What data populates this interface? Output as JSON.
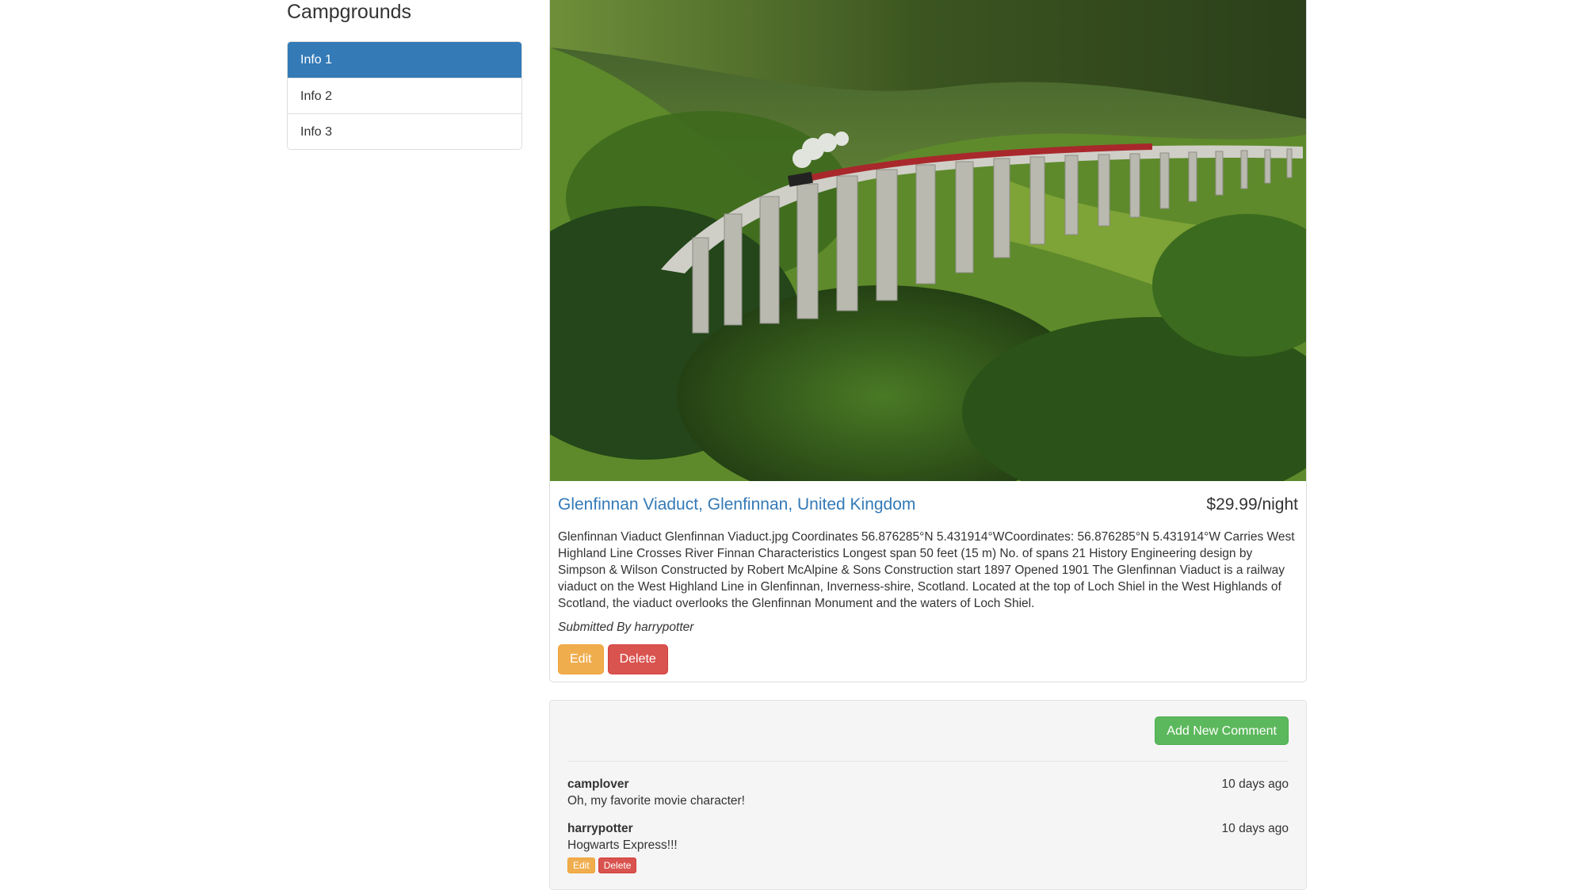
{
  "sidebar": {
    "heading": "Campgrounds",
    "items": [
      {
        "label": "Info 1",
        "active": true
      },
      {
        "label": "Info 2",
        "active": false
      },
      {
        "label": "Info 3",
        "active": false
      }
    ]
  },
  "campground": {
    "image_alt": "Steam train crossing a curved stone viaduct over green hills",
    "title": "Glenfinnan Viaduct, Glenfinnan, United Kingdom",
    "price": "$29.99/night",
    "description": "Glenfinnan Viaduct Glenfinnan Viaduct.jpg Coordinates 56.876285°N 5.431914°WCoordinates: 56.876285°N 5.431914°W Carries West Highland Line Crosses River Finnan Characteristics Longest span 50 feet (15 m) No. of spans 21 History Engineering design by Simpson & Wilson Constructed by Robert McAlpine & Sons Construction start 1897 Opened 1901 The Glenfinnan Viaduct is a railway viaduct on the West Highland Line in Glenfinnan, Inverness-shire, Scotland. Located at the top of Loch Shiel in the West Highlands of Scotland, the viaduct overlooks the Glenfinnan Monument and the waters of Loch Shiel.",
    "submitted_by": "Submitted By harrypotter",
    "edit_label": "Edit",
    "delete_label": "Delete"
  },
  "comments_section": {
    "add_label": "Add New Comment",
    "comments": [
      {
        "author": "camplover",
        "date": "10 days ago",
        "text": "Oh, my favorite movie character!",
        "has_actions": false
      },
      {
        "author": "harrypotter",
        "date": "10 days ago",
        "text": "Hogwarts Express!!!",
        "has_actions": true,
        "edit_label": "Edit",
        "delete_label": "Delete"
      }
    ]
  },
  "colors": {
    "primary": "#337ab7",
    "warning": "#f0ad4e",
    "danger": "#d9534f",
    "success": "#5cb85c",
    "well_bg": "#f5f5f5"
  }
}
